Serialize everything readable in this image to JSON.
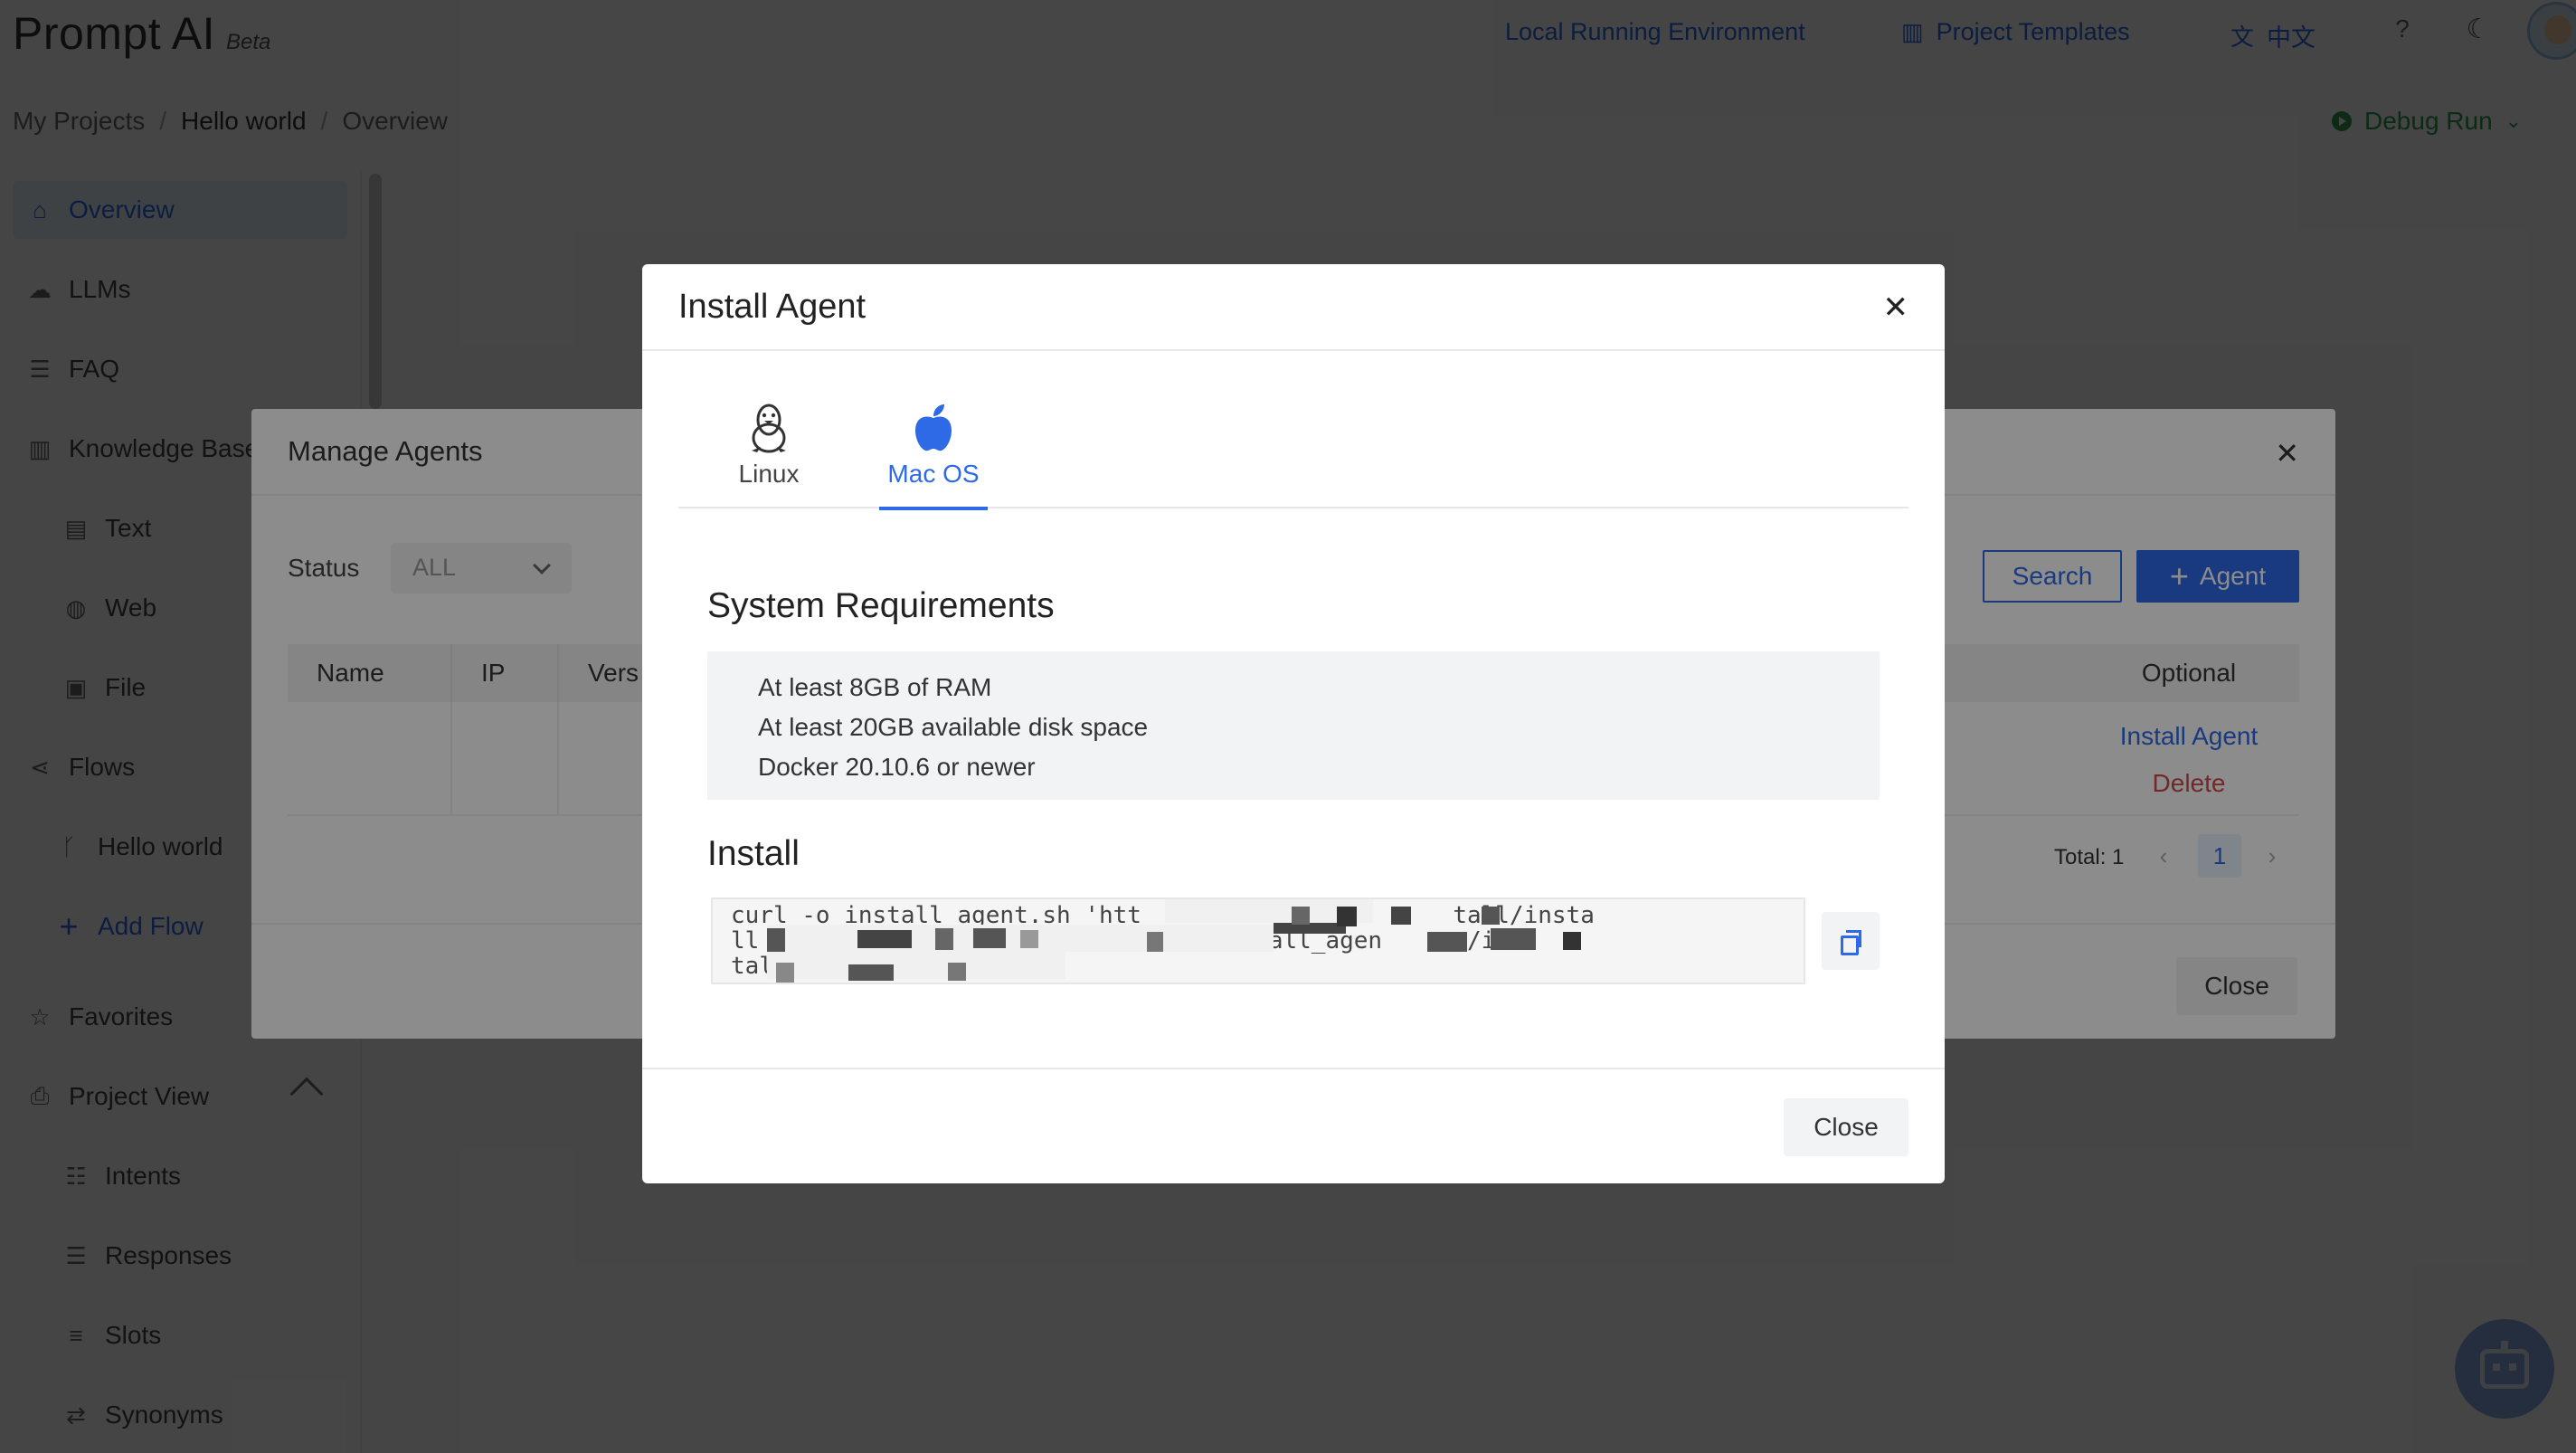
{
  "app": {
    "name": "Prompt AI",
    "badge": "Beta"
  },
  "topnav": {
    "env": "Local Running Environment",
    "templates": "Project Templates",
    "lang": "中文",
    "help": "?"
  },
  "breadcrumb": [
    "My Projects",
    "Hello world",
    "Overview"
  ],
  "debug_run": "Debug Run",
  "sidebar": {
    "items": [
      {
        "label": "Overview",
        "icon": "home-icon"
      },
      {
        "label": "LLMs",
        "icon": "cloud-icon"
      },
      {
        "label": "FAQ",
        "icon": "list-icon"
      },
      {
        "label": "Knowledge Base",
        "icon": "book-icon"
      },
      {
        "label": "Text",
        "icon": "document-icon"
      },
      {
        "label": "Web",
        "icon": "globe-icon"
      },
      {
        "label": "File",
        "icon": "file-icon"
      },
      {
        "label": "Flows",
        "icon": "flow-icon"
      },
      {
        "label": "Hello world",
        "icon": "branch-icon"
      },
      {
        "label": "Add Flow",
        "icon": "plus-icon"
      },
      {
        "label": "Favorites",
        "icon": "star-icon"
      },
      {
        "label": "Project View",
        "icon": "project-icon"
      },
      {
        "label": "Intents",
        "icon": "intents-icon"
      },
      {
        "label": "Responses",
        "icon": "responses-icon"
      },
      {
        "label": "Slots",
        "icon": "slots-icon"
      },
      {
        "label": "Synonyms",
        "icon": "synonyms-icon"
      }
    ]
  },
  "manage_agents": {
    "title": "Manage Agents",
    "status_label": "Status",
    "status_value": "ALL",
    "search_label": "Search",
    "add_label": "Agent",
    "columns": [
      "Name",
      "IP",
      "Vers",
      "Optional"
    ],
    "row_actions": {
      "install": "Install Agent",
      "delete": "Delete"
    },
    "total": "Total: 1",
    "page": "1",
    "close_label": "Close"
  },
  "install_agent": {
    "title": "Install Agent",
    "tabs": [
      {
        "label": "Linux",
        "icon": "linux-tux-icon"
      },
      {
        "label": "Mac OS",
        "icon": "apple-icon"
      }
    ],
    "active_tab": "Mac OS",
    "requirements_title": "System Requirements",
    "requirements": [
      "At least 8GB of RAM",
      "At least 20GB available disk space",
      "Docker 20.10.6 or newer"
    ],
    "install_title": "Install",
    "install_command_lines": [
      "curl -o install_agent.sh 'htt                      tall/insta",
      "ll                    && chmod +x install_agen      /ins",
      "tal"
    ],
    "close_label": "Close"
  },
  "colors": {
    "primary": "#2e6ae6",
    "danger": "#d14a4a",
    "success": "#2c9a4a"
  }
}
